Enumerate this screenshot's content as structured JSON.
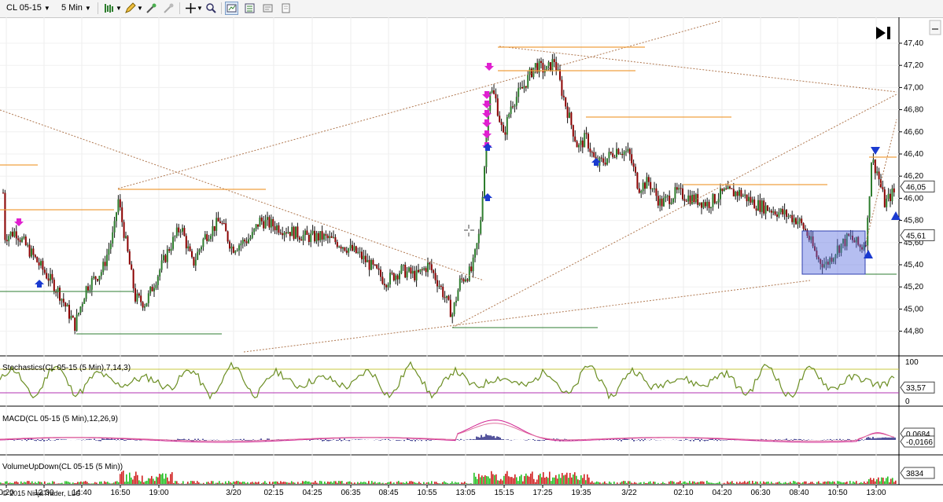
{
  "toolbar": {
    "instrument": "CL 05-15",
    "interval": "5 Min",
    "icons": [
      "bar-type-icon",
      "pencil-icon",
      "magic-wand-icon",
      "crosshair-icon",
      "zoom-icon",
      "chart-style-icon",
      "data-box-icon",
      "properties-icon",
      "template-icon"
    ]
  },
  "price_axis": {
    "ticks": [
      "47,40",
      "47,20",
      "47,00",
      "46,80",
      "46,60",
      "46,40",
      "46,20",
      "46,00",
      "45,80",
      "45,60",
      "45,40",
      "45,20",
      "45,00",
      "44,80"
    ],
    "values": [
      47.4,
      47.2,
      47.0,
      46.8,
      46.6,
      46.4,
      46.2,
      46.0,
      45.8,
      45.6,
      45.4,
      45.2,
      45.0,
      44.8
    ],
    "last_price": "46,05",
    "marker_price": "45,61"
  },
  "time_axis": [
    "0:20",
    "12:30",
    "14:40",
    "16:50",
    "19:00",
    "3/20",
    "02:15",
    "04:25",
    "06:35",
    "08:45",
    "10:55",
    "13:05",
    "15:15",
    "17:25",
    "19:35",
    "3/22",
    "02:10",
    "04:20",
    "06:30",
    "08:40",
    "10:50",
    "13:00"
  ],
  "stochastics": {
    "label": "Stochastics(CL 05-15 (5 Min),7,14,3)",
    "ticks": [
      "100",
      "0"
    ],
    "value": "33,57"
  },
  "macd": {
    "label": "MACD(CL 05-15 (5 Min),12,26,9)",
    "value1": "0,0684",
    "value2": "-0,0166"
  },
  "volume": {
    "label": "VolumeUpDown(CL 05-15 (5 Min))",
    "value": "3834"
  },
  "copyright": "© 2015 NinjaTrader, LLC",
  "colors": {
    "up_candle": "#2d7d2d",
    "down_candle": "#8b0000",
    "orange_line": "#f0a040",
    "green_line": "#2e7d32",
    "blue_box": "#5b6ee0",
    "stoch": "#6b8e23",
    "macd_hist": "#1a1a7a",
    "macd_line": "#d02090",
    "vol_up": "#22c022",
    "vol_down": "#d02020"
  }
}
